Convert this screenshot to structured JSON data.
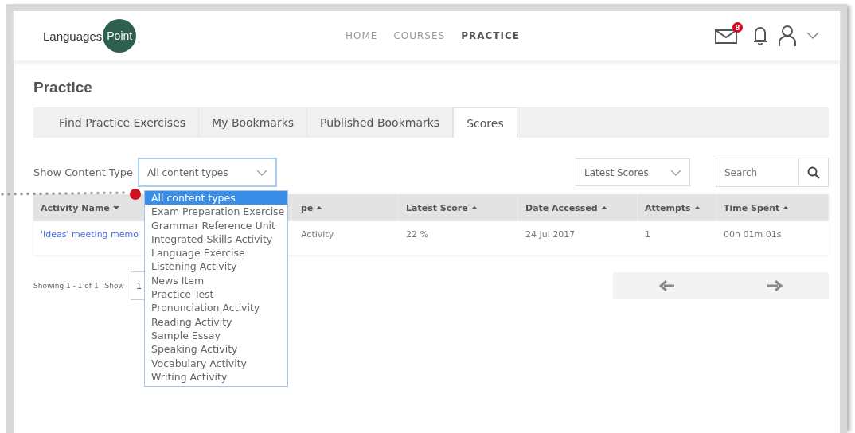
{
  "header": {
    "logo": {
      "word": "Languages",
      "badge": "Point"
    },
    "nav": [
      {
        "label": "HOME",
        "selected": false
      },
      {
        "label": "COURSES",
        "selected": false
      },
      {
        "label": "PRACTICE",
        "selected": true
      }
    ],
    "mail_badge": "8"
  },
  "page_title": "Practice",
  "tabs": [
    {
      "label": "Find Practice Exercises",
      "selected": false
    },
    {
      "label": "My Bookmarks",
      "selected": false
    },
    {
      "label": "Published Bookmarks",
      "selected": false
    },
    {
      "label": "Scores",
      "selected": true
    }
  ],
  "filters": {
    "content_type_label": "Show Content Type",
    "content_type_value": "All content types",
    "sort_value": "Latest Scores",
    "search": {
      "placeholder": "Search"
    }
  },
  "table": {
    "columns": [
      {
        "label": "Activity Name",
        "descending": true
      },
      {
        "label": "pe",
        "descending": false
      },
      {
        "label": "Latest Score",
        "descending": false
      },
      {
        "label": "Date Accessed",
        "descending": false
      },
      {
        "label": "Attempts",
        "descending": false
      },
      {
        "label": "Time Spent",
        "descending": false
      }
    ],
    "rows": [
      {
        "cells": [
          "'Ideas' meeting memo",
          "Activity",
          "22 %",
          "24 Jul 2017",
          "1",
          "00h 01m 01s"
        ]
      }
    ]
  },
  "pagination": {
    "summary": "Showing 1 - 1 of 1",
    "show_label": "Show",
    "page_size": "1"
  },
  "dropdown": {
    "options": [
      {
        "label": "All content types",
        "selected": true
      },
      {
        "label": "Exam Preparation Exercise",
        "selected": false
      },
      {
        "label": "Grammar Reference Unit",
        "selected": false
      },
      {
        "label": "Integrated Skills Activity",
        "selected": false
      },
      {
        "label": "Language Exercise",
        "selected": false
      },
      {
        "label": "Listening Activity",
        "selected": false
      },
      {
        "label": "News Item",
        "selected": false
      },
      {
        "label": "Practice Test",
        "selected": false
      },
      {
        "label": "Pronunciation Activity",
        "selected": false
      },
      {
        "label": "Reading Activity",
        "selected": false
      },
      {
        "label": "Sample Essay",
        "selected": false
      },
      {
        "label": "Speaking Activity",
        "selected": false
      },
      {
        "label": "Vocabulary Activity",
        "selected": false
      },
      {
        "label": "Writing Activity",
        "selected": false
      }
    ]
  }
}
